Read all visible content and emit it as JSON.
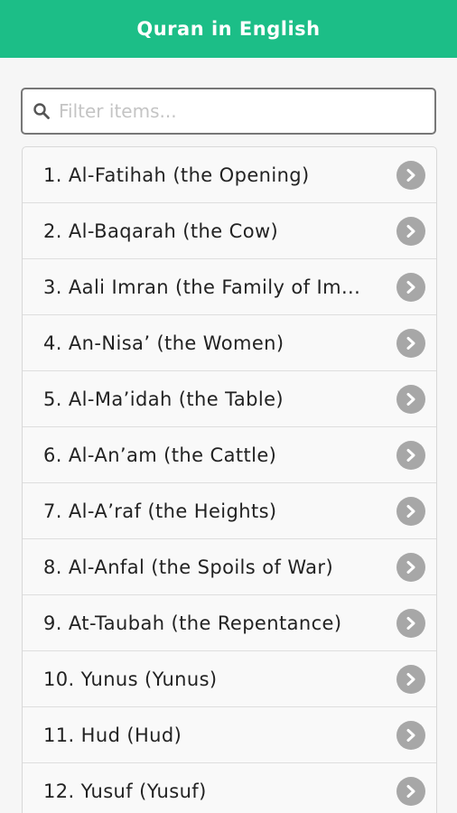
{
  "header": {
    "title": "Quran in English",
    "bg_color": "#1cbe87"
  },
  "search": {
    "placeholder": "Filter items...",
    "value": "",
    "icon": "search-icon"
  },
  "list": {
    "items": [
      {
        "label": "1. Al-Fatihah (the Opening)",
        "icon": "chevron-right-icon"
      },
      {
        "label": "2. Al-Baqarah (the Cow)",
        "icon": "chevron-right-icon"
      },
      {
        "label": "3. Aali Imran (the Family of Im...",
        "icon": "chevron-right-icon"
      },
      {
        "label": "4. An-Nisa’ (the Women)",
        "icon": "chevron-right-icon"
      },
      {
        "label": "5. Al-Ma’idah (the Table)",
        "icon": "chevron-right-icon"
      },
      {
        "label": "6. Al-An’am (the Cattle)",
        "icon": "chevron-right-icon"
      },
      {
        "label": "7. Al-A’raf (the Heights)",
        "icon": "chevron-right-icon"
      },
      {
        "label": "8. Al-Anfal (the Spoils of War)",
        "icon": "chevron-right-icon"
      },
      {
        "label": "9. At-Taubah (the Repentance)",
        "icon": "chevron-right-icon"
      },
      {
        "label": "10. Yunus (Yunus)",
        "icon": "chevron-right-icon"
      },
      {
        "label": "11. Hud (Hud)",
        "icon": "chevron-right-icon"
      },
      {
        "label": "12. Yusuf (Yusuf)",
        "icon": "chevron-right-icon"
      }
    ]
  }
}
